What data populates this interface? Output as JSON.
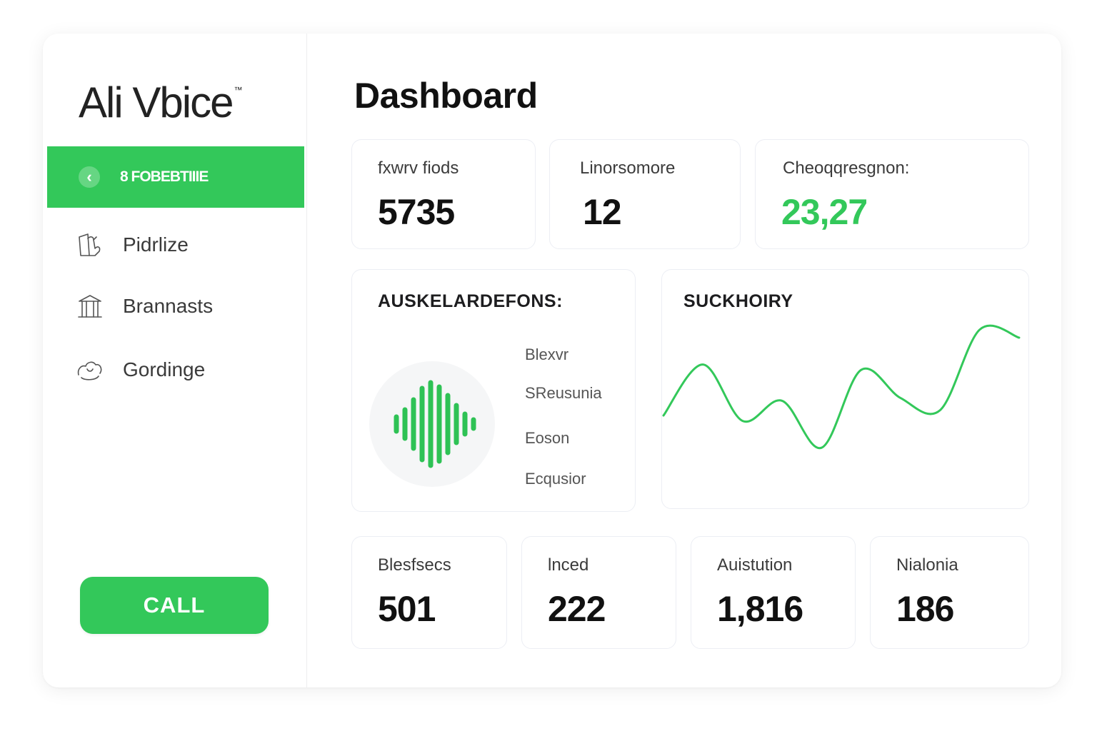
{
  "sidebar": {
    "logo": "Ali Vbice",
    "logo_mark": "™",
    "active_item": {
      "label": "8 FOBEBTIIIE",
      "icon": "chevron-left-icon"
    },
    "items": [
      {
        "label": "Pidrlize",
        "icon": "hand-icon"
      },
      {
        "label": "Brannasts",
        "icon": "building-icon"
      },
      {
        "label": "Gordinge",
        "icon": "hands-icon"
      }
    ],
    "call_label": "CALL"
  },
  "main": {
    "title": "Dashboard",
    "top_stats": [
      {
        "label": "fxwrv fiods",
        "value": "5735"
      },
      {
        "label": "Linorsomore",
        "value": "12"
      },
      {
        "label": "Cheoqqresgnon:",
        "value": "23,27"
      }
    ],
    "audio_card": {
      "title": "AUSKELARDEFONS:",
      "legend": [
        "Blexvr",
        "SReusunia",
        "Eoson",
        "Ecqusior"
      ]
    },
    "line_card": {
      "title": "SUCKHOIRY"
    },
    "bottom_stats": [
      {
        "label": "Blesfsecs",
        "value": "501"
      },
      {
        "label": "lnced",
        "value": "222"
      },
      {
        "label": "Auistution",
        "value": "1,816"
      },
      {
        "label": "Nialonia",
        "value": "186"
      }
    ]
  },
  "colors": {
    "accent": "#33c85a",
    "text": "#111111",
    "card_border": "#eceef4"
  },
  "chart_data": {
    "type": "line",
    "title": "SUCKHOIRY",
    "xlabel": "",
    "ylabel": "",
    "grid": false,
    "series": [
      {
        "values": [
          0.34,
          0.72,
          0.3,
          0.45,
          0.1,
          0.68,
          0.47,
          0.38,
          0.98,
          0.92
        ]
      }
    ],
    "ylim": [
      0,
      1
    ]
  }
}
